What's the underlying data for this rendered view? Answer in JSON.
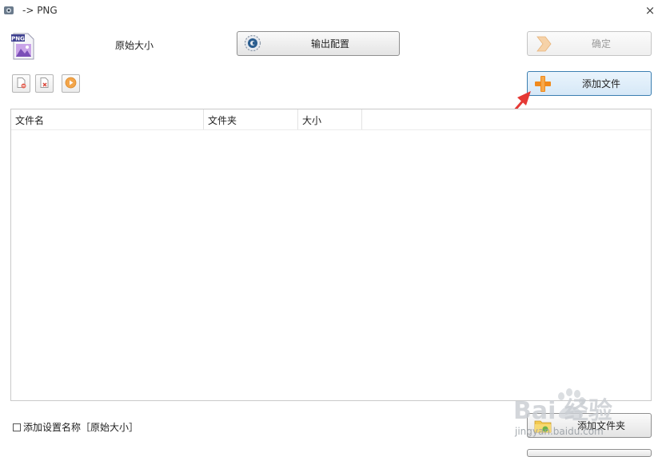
{
  "window": {
    "title": "-> PNG",
    "close_glyph": "×"
  },
  "top": {
    "format_icon": "png-image-icon",
    "format_icon_text": "PNG",
    "size_label": "原始大小",
    "output_config_label": "输出配置",
    "confirm_label": "确定"
  },
  "toolbar": {
    "add_icon": "add-file-icon",
    "remove_icon": "remove-file-icon",
    "start_icon": "play-icon",
    "add_file_label": "添加文件"
  },
  "file_list": {
    "columns": [
      "文件名",
      "文件夹",
      "大小"
    ],
    "rows": []
  },
  "bottom": {
    "checkbox_label": "添加设置名称［原始大小］",
    "checkbox_checked": false,
    "add_folder_label": "添加文件夹"
  },
  "watermark": {
    "text_main": "Bai 经验",
    "text_sub": "jingyan.baidu.com"
  },
  "colors": {
    "accent_blue": "#3c7fb1",
    "annotation_red": "#e53935",
    "plus_orange": "#f08a1c"
  }
}
